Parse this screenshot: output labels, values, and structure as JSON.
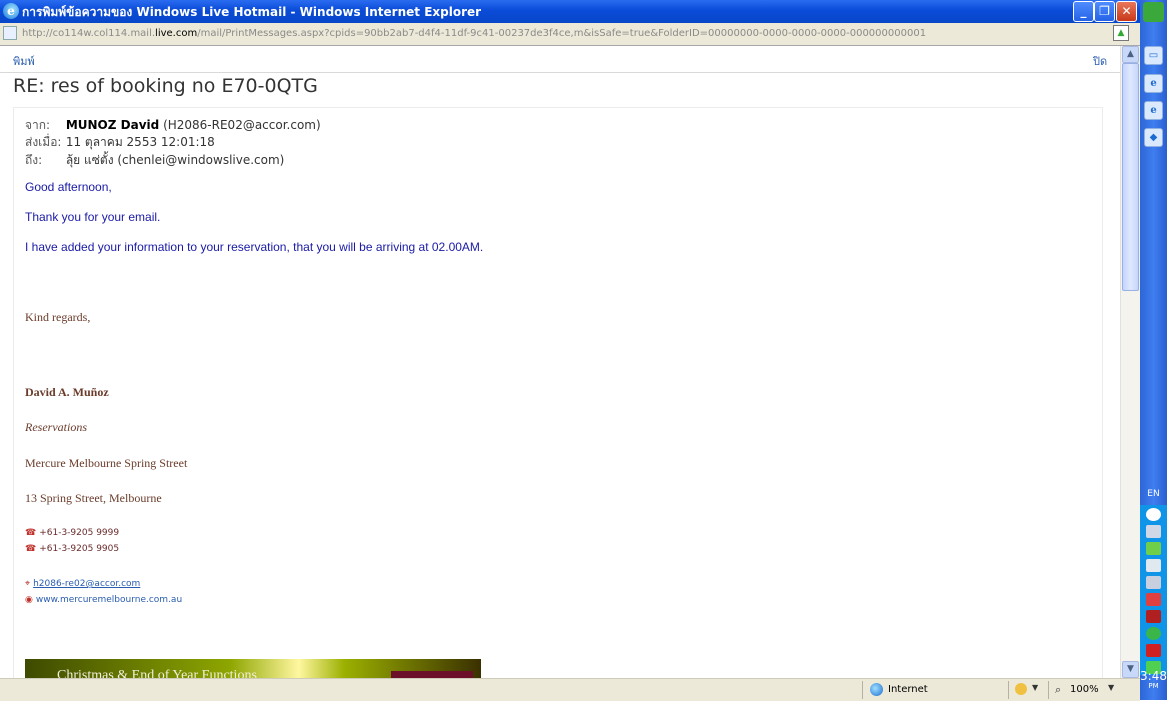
{
  "window": {
    "title": "การพิมพ์ข้อความของ Windows Live Hotmail - Windows Internet Explorer",
    "url_prefix": "http://co114w.col114.mail.",
    "url_domain": "live.com",
    "url_suffix": "/mail/PrintMessages.aspx?cpids=90bb2ab7-d4f4-11df-9c41-00237de3f4ce,m&isSafe=true&FolderID=00000000-0000-0000-0000-000000000001"
  },
  "toolbar": {
    "print_label": "พิมพ์",
    "close_label": "ปิด"
  },
  "message": {
    "subject": "RE: res of booking no E70-0QTG",
    "from_label": "จาก:",
    "from_name": "MUNOZ David",
    "from_email": "(H2086-RE02@accor.com)",
    "sent_label": "ส่งเมื่อ:",
    "sent_value": "11 ตุลาคม 2553 12:01:18",
    "to_label": "ถึง:",
    "to_value": "ลุ้ย แซ่ตั้ง (chenlei@windowslive.com)",
    "body": {
      "greeting": "Good afternoon,",
      "thanks": "Thank you for your email.",
      "info": "I have added your information to your reservation, that you will be arriving at 02.00AM.",
      "regards": "Kind regards,"
    },
    "signature": {
      "name": "David A. Muñoz",
      "role": "Reservations",
      "hotel": "Mercure Melbourne Spring Street",
      "address": "13 Spring Street, Melbourne",
      "phone": "+61-3-9205 9999",
      "fax": "+61-3-9205 9905",
      "email": "h2086-re02@accor.com",
      "website": "www.mercuremelbourne.com.au"
    },
    "banner_text": "Christmas & End of Year Functions"
  },
  "statusbar": {
    "zone": "Internet",
    "zoom": "100%"
  },
  "taskbar": {
    "language": "EN",
    "clock_time": "3:48",
    "clock_ampm": "PM"
  },
  "colors": {
    "body_text": "#1a1aa6",
    "signature_text": "#6a3b2a",
    "link": "#2a5db0",
    "titlebar": "#0a4bd8"
  }
}
